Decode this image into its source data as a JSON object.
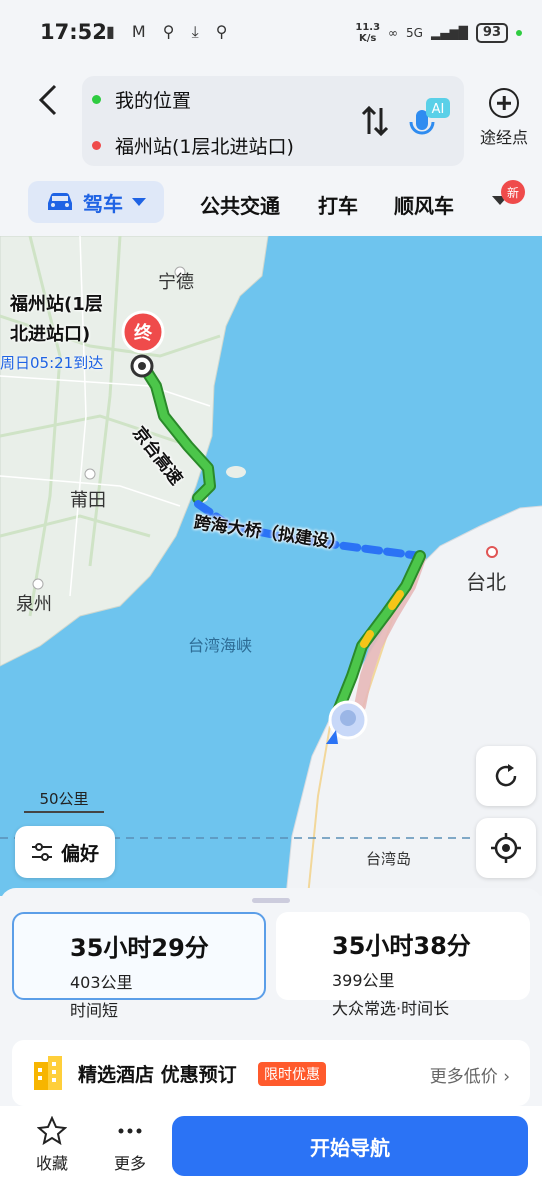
{
  "status": {
    "time": "17:52",
    "net_speed_top": "11.3",
    "net_speed_bottom": "K/s",
    "network": "5G",
    "battery": "93"
  },
  "route": {
    "origin": "我的位置",
    "destination": "福州站(1层北进站口)",
    "via_label": "途经点",
    "mic_badge": "AI",
    "origin_color": "#2ecc40",
    "destination_color": "#ef4b4b"
  },
  "modes": {
    "drive": "驾车",
    "transit": "公共交通",
    "taxi": "打车",
    "carpool": "顺风车",
    "new_badge": "新",
    "accent": "#1f63e4"
  },
  "map": {
    "places": {
      "ningde": "宁德",
      "putian": "莆田",
      "quanzhou": "泉州",
      "taipei": "台北",
      "strait": "台湾海峡",
      "island": "台湾岛"
    },
    "dest_marker": "终",
    "dest_label_line1": "福州站(1层",
    "dest_label_line2": "北进站口)",
    "arrive_text": "周日05:21到达",
    "road_1": "京台高速",
    "road_2": "跨海大桥（拟建设）",
    "scale": "50公里",
    "preference": "偏好"
  },
  "routes": [
    {
      "duration": "35小时29分",
      "distance": "403公里",
      "tag": "时间短"
    },
    {
      "duration": "35小时38分",
      "distance": "399公里",
      "tag": "大众常选·时间长"
    }
  ],
  "hotel": {
    "title": "精选酒店 优惠预订",
    "promo": "限时优惠",
    "more": "更多低价"
  },
  "bottom": {
    "favorite": "收藏",
    "more": "更多",
    "start": "开始导航"
  }
}
